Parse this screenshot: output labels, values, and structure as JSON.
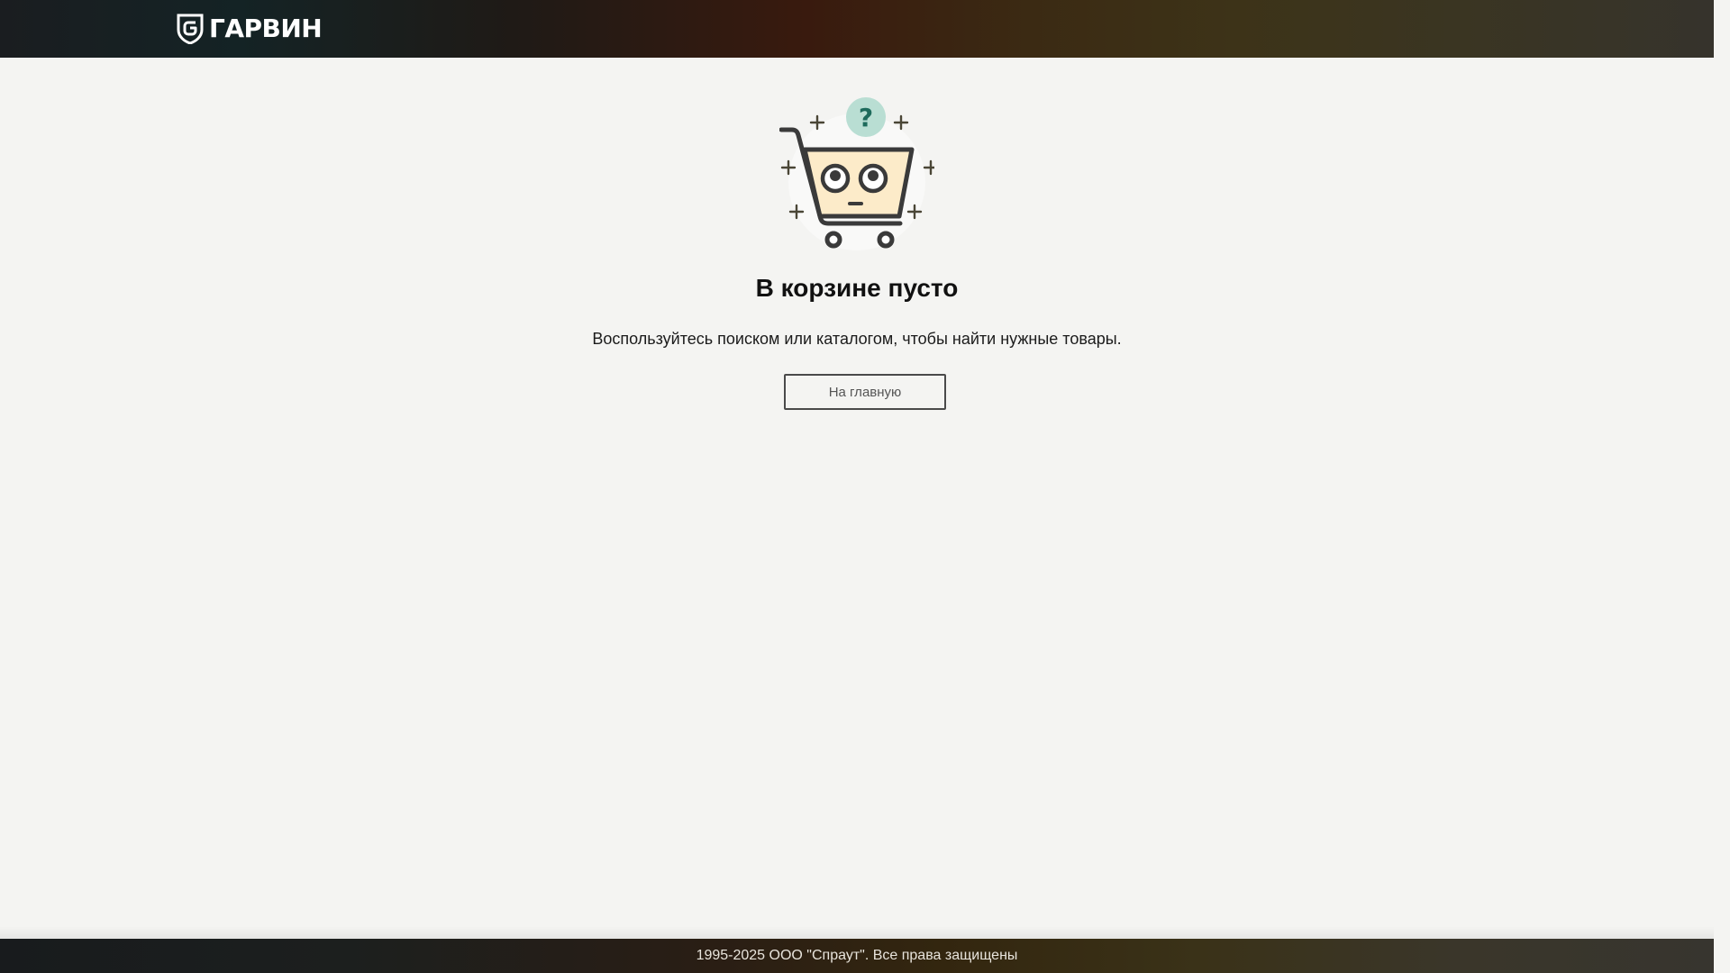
{
  "header": {
    "logo_text": "ГАРВИН",
    "logo_icon": "garvin-g-shield-icon"
  },
  "empty_cart": {
    "illustration": "empty-cart-question-icon",
    "title": "В корзине пусто",
    "message": "Воспользуйтесь поиском или каталогом, чтобы найти нужные товары.",
    "home_button_label": "На главную"
  },
  "footer": {
    "copyright": "1995-2025 ООО \"Спраут\". Все права защищены"
  },
  "colors": {
    "accent_teal": "#1e6b5c",
    "cart_fill": "#fcebc9",
    "outline_dark": "#3a3a3a"
  }
}
